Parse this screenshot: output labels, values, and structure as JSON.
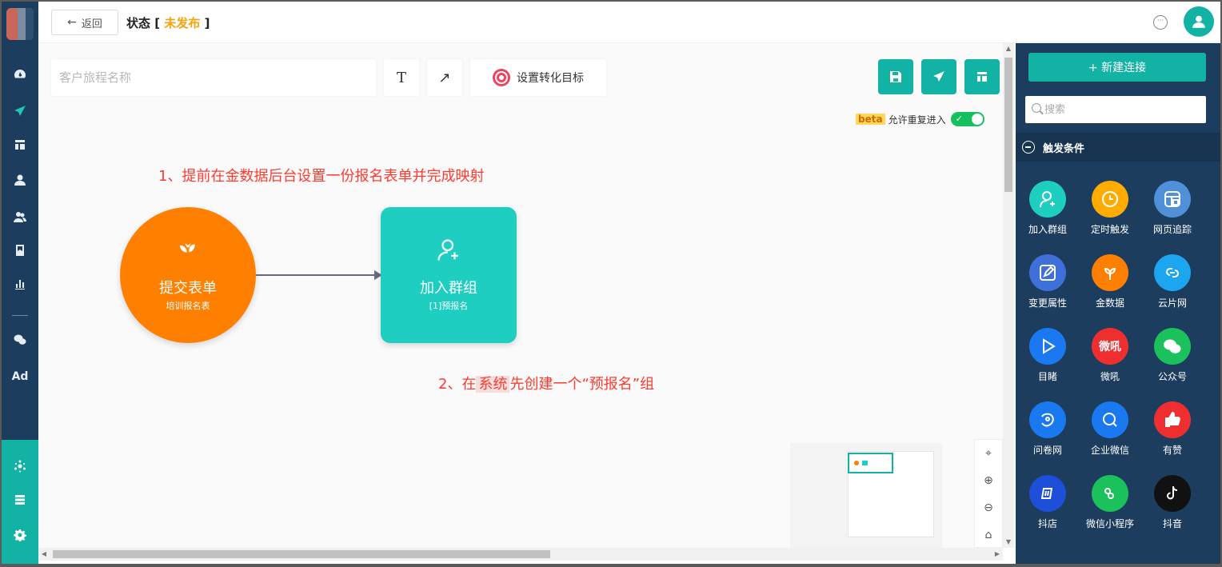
{
  "topbar": {
    "back_label": "返回",
    "status_label": "状态",
    "status_value": "未发布"
  },
  "toolbar": {
    "name_placeholder": "客户旅程名称",
    "text_tool": "T",
    "arrow_tool": "↗",
    "goal_label": "设置转化目标",
    "beta": "beta",
    "reentry_label": "允许重复进入",
    "reentry_enabled": true
  },
  "annotations": {
    "step1": "1、提前在金数据后台设置一份报名表单并完成映射",
    "step2_a": "2、在",
    "step2_b": "系统",
    "step2_c": "先创建一个“预报名”组"
  },
  "nodes": [
    {
      "title": "提交表单",
      "subtitle": "培训报名表",
      "color": "#ff8000",
      "icon": "sprout-icon"
    },
    {
      "title": "加入群组",
      "subtitle": "[1]预报名",
      "color": "#1ecfc1",
      "icon": "add-user-icon"
    }
  ],
  "right_panel": {
    "new_connection": "+ 新建连接",
    "search_placeholder": "搜索",
    "section_title": "触发条件",
    "tiles": [
      {
        "label": "加入群组",
        "color": "#1ecfc1",
        "icon": "add-user-icon"
      },
      {
        "label": "定时触发",
        "color": "#ffab00",
        "icon": "clock-icon"
      },
      {
        "label": "网页追踪",
        "color": "#4f90d8",
        "icon": "webpage-icon"
      },
      {
        "label": "变更属性",
        "color": "#3f6fd8",
        "icon": "edit-icon"
      },
      {
        "label": "金数据",
        "color": "#ff8000",
        "icon": "sprout-icon"
      },
      {
        "label": "云片网",
        "color": "#1ca6f0",
        "icon": "cloud-link-icon"
      },
      {
        "label": "目睹",
        "color": "#1a78f0",
        "icon": "play-icon"
      },
      {
        "label": "微吼",
        "color": "#ef2f2f",
        "icon": "vhall-icon",
        "glyph": "微吼"
      },
      {
        "label": "公众号",
        "color": "#1bc15b",
        "icon": "wechat-icon"
      },
      {
        "label": "问卷网",
        "color": "#1a78f0",
        "icon": "wenjuan-icon"
      },
      {
        "label": "企业微信",
        "color": "#1a78f0",
        "icon": "wecom-icon"
      },
      {
        "label": "有赞",
        "color": "#ef2f2f",
        "icon": "thumbs-up-icon"
      },
      {
        "label": "抖店",
        "color": "#1d4fd8",
        "icon": "doudian-icon"
      },
      {
        "label": "微信小程序",
        "color": "#1bc15b",
        "icon": "mini-program-icon"
      },
      {
        "label": "抖音",
        "color": "#111111",
        "icon": "tiktok-icon"
      }
    ]
  },
  "left_nav": [
    "dashboard-icon",
    "send-icon",
    "layout-icon",
    "user-icon",
    "users-icon",
    "bookmark-icon",
    "chart-icon",
    "wechat-icon",
    "ad-icon",
    "hub-icon",
    "server-icon",
    "gear-icon"
  ],
  "left_nav_ad": "Ad"
}
